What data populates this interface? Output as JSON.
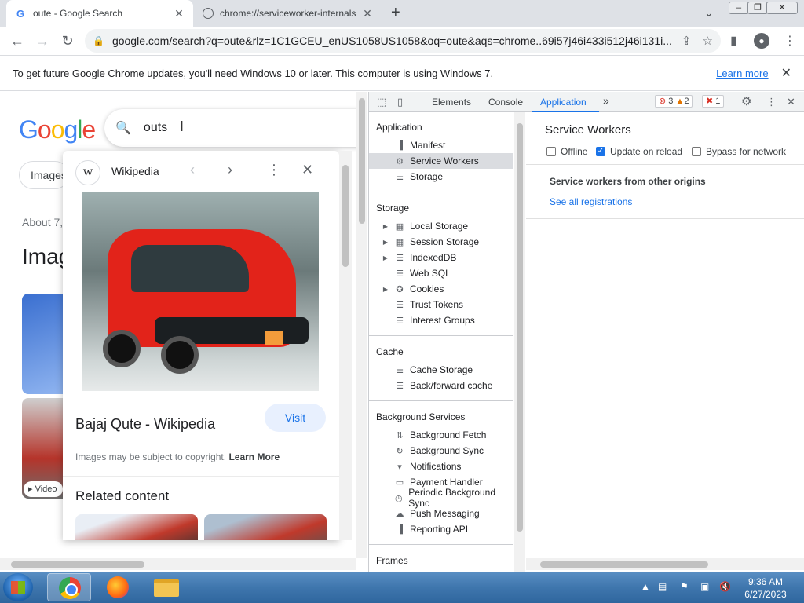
{
  "browser": {
    "tabs": [
      {
        "title": "oute - Google Search",
        "favicon": "google-g-icon",
        "active": true
      },
      {
        "title": "chrome://serviceworker-internals",
        "favicon": "globe-icon",
        "active": false
      }
    ],
    "new_tab_glyph": "+",
    "address": "google.com/search?q=oute&rlz=1C1GCEU_enUS1058US1058&oq=oute&aqs=chrome..69i57j46i433i512j46i131i...",
    "window_controls": [
      "–",
      "❐",
      "✕"
    ]
  },
  "infobar": {
    "message": "To get future Google Chrome updates, you'll need Windows 10 or later. This computer is using Windows 7.",
    "link": "Learn more",
    "close": "✕"
  },
  "google": {
    "logo_letters": [
      "G",
      "o",
      "o",
      "g",
      "l",
      "e"
    ],
    "query": "outs",
    "chip_label": "Images",
    "about_text": "About 7,",
    "images_heading": "Imag",
    "video_tag": "Video"
  },
  "preview": {
    "source_glyph": "W",
    "source_name": "Wikipedia",
    "title": "Bajaj Qute - Wikipedia",
    "visit_label": "Visit",
    "copyright_text": "Images may be subject to copyright.",
    "copyright_link": "Learn More",
    "related_heading": "Related content"
  },
  "devtools": {
    "tabs": [
      "Elements",
      "Console",
      "Application"
    ],
    "active_tab": "Application",
    "more_tabs": "»",
    "errors": "3",
    "warnings": "2",
    "issues": "1",
    "sidebar": {
      "application_heading": "Application",
      "application_items": [
        "Manifest",
        "Service Workers",
        "Storage"
      ],
      "selected_item": "Service Workers",
      "storage_heading": "Storage",
      "storage_items": [
        "Local Storage",
        "Session Storage",
        "IndexedDB",
        "Web SQL",
        "Cookies",
        "Trust Tokens",
        "Interest Groups"
      ],
      "cache_heading": "Cache",
      "cache_items": [
        "Cache Storage",
        "Back/forward cache"
      ],
      "bg_heading": "Background Services",
      "bg_items": [
        "Background Fetch",
        "Background Sync",
        "Notifications",
        "Payment Handler",
        "Periodic Background Sync",
        "Push Messaging",
        "Reporting API"
      ],
      "frames_heading": "Frames"
    },
    "main": {
      "title": "Service Workers",
      "options": [
        {
          "label": "Offline",
          "checked": false
        },
        {
          "label": "Update on reload",
          "checked": true
        },
        {
          "label": "Bypass for network",
          "checked": false
        }
      ],
      "other_origins": "Service workers from other origins",
      "see_all": "See all registrations"
    }
  },
  "taskbar": {
    "time": "9:36 AM",
    "date": "6/27/2023"
  },
  "colors": {
    "google_blue": "#4285f4",
    "devtools_accent": "#1a73e8",
    "taskbar": "#3f76ad"
  }
}
